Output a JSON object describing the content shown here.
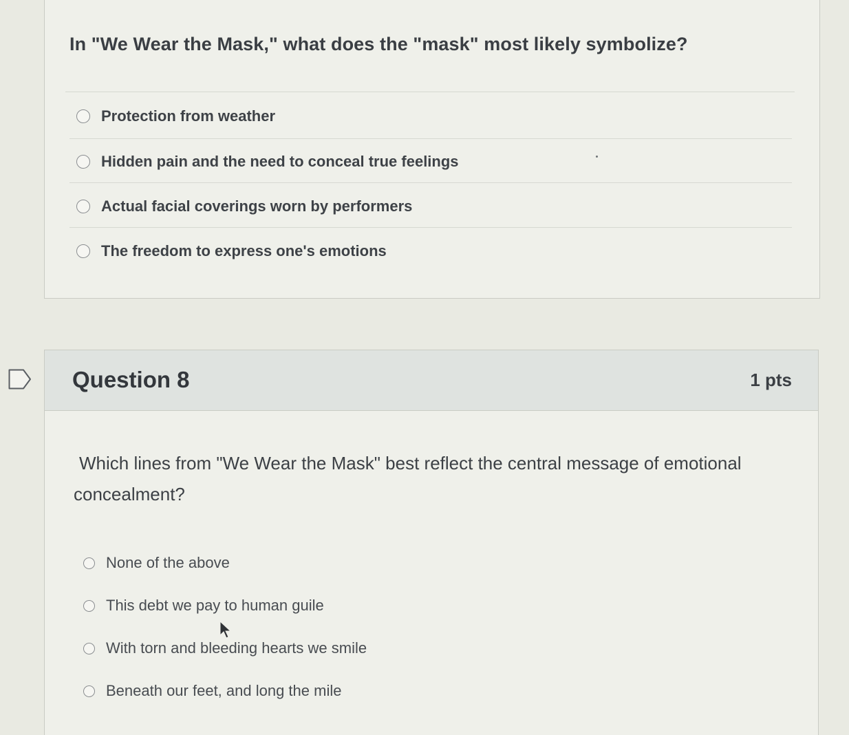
{
  "previous_question": {
    "text": "In \"We Wear the Mask,\" what does the \"mask\" most likely symbolize?",
    "answers": [
      "Protection from weather",
      "Hidden pain and the need to conceal true feelings",
      "Actual facial coverings worn by performers",
      "The freedom to express one's emotions"
    ]
  },
  "question_8": {
    "title": "Question 8",
    "points": "1 pts",
    "text": "Which lines from \"We Wear the Mask\" best reflect the central message of emotional concealment?",
    "answers": [
      "None of the above",
      "This debt we pay to human guile",
      "With torn and bleeding hearts we smile",
      "Beneath our feet, and long the mile"
    ]
  },
  "icons": {
    "flag": "flag-question-icon",
    "cursor": "mouse-pointer-icon"
  },
  "colors": {
    "page_background": "#e9eae2",
    "card_background": "#eff0ea",
    "header_background": "#dfe3e0",
    "text": "#3b3f44"
  }
}
